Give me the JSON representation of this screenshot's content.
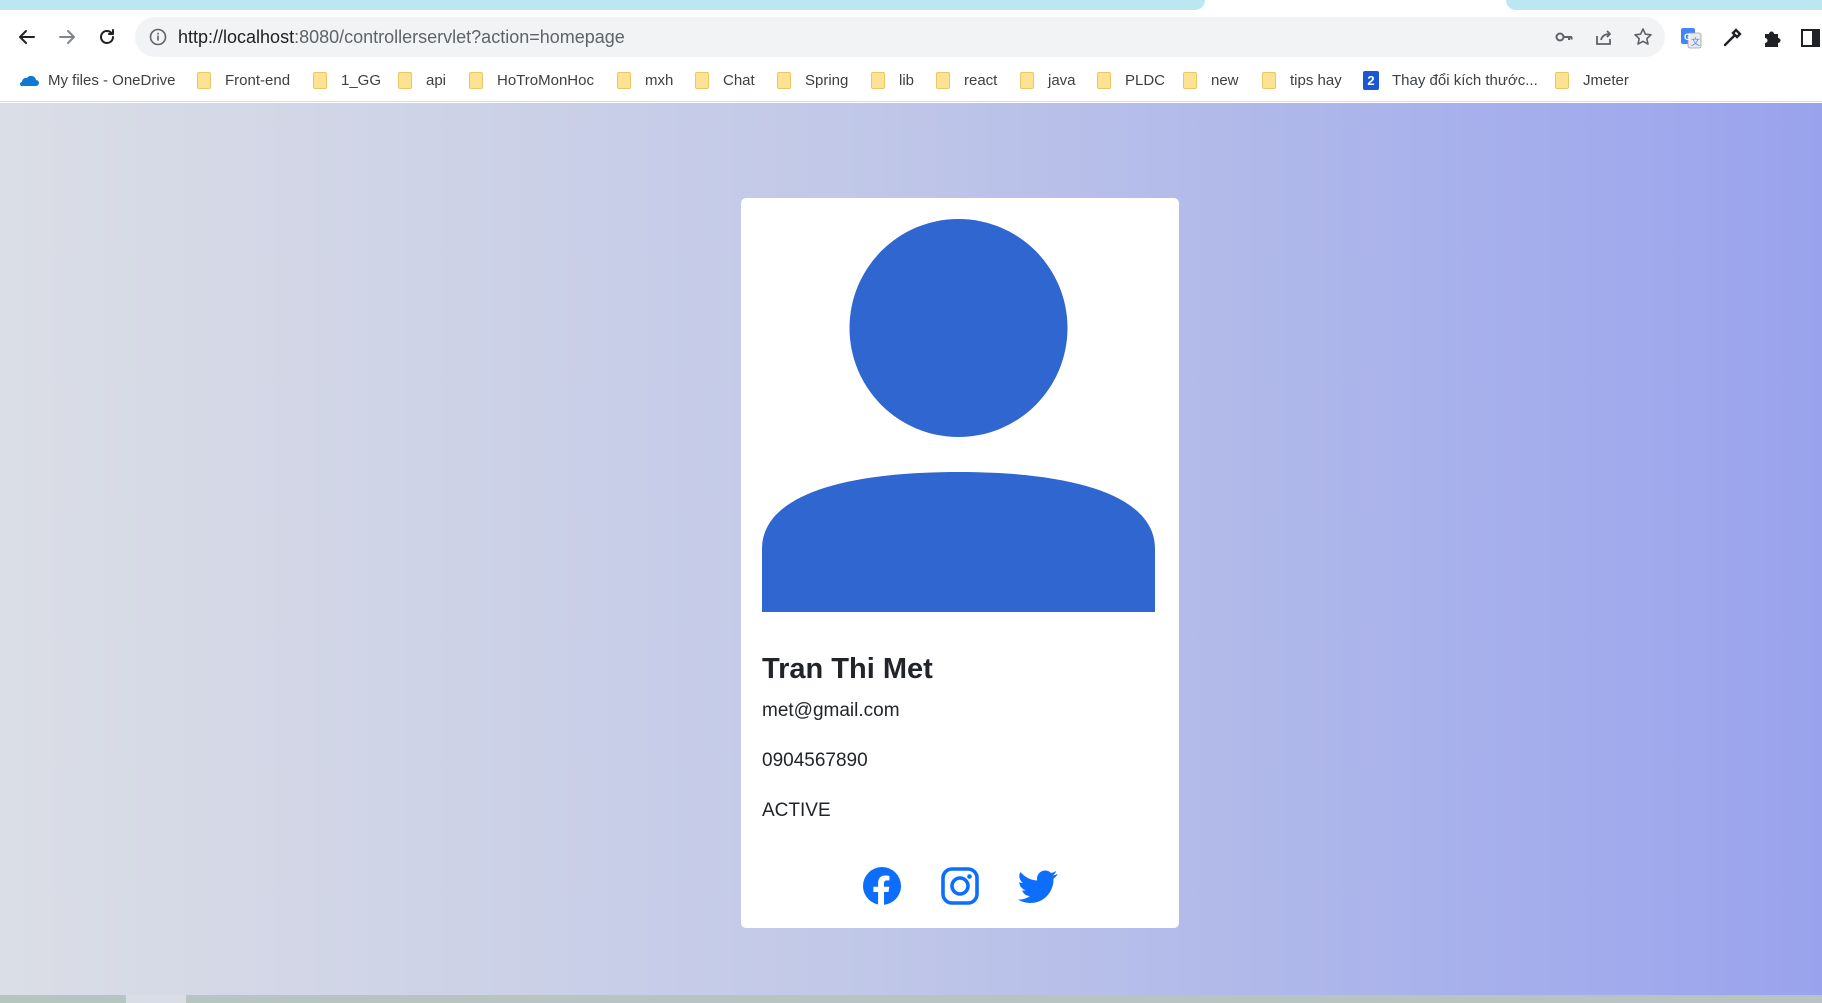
{
  "browser": {
    "url_host": "http://localhost",
    "url_path": ":8080/controllerservlet?action=homepage"
  },
  "bookmarks": [
    {
      "label": "My files - OneDrive",
      "icon": "onedrive-icon"
    },
    {
      "label": "Front-end",
      "icon": "folder-icon"
    },
    {
      "label": "1_GG",
      "icon": "folder-icon"
    },
    {
      "label": "api",
      "icon": "folder-icon"
    },
    {
      "label": "HoTroMonHoc",
      "icon": "folder-icon"
    },
    {
      "label": "mxh",
      "icon": "folder-icon"
    },
    {
      "label": "Chat",
      "icon": "folder-icon"
    },
    {
      "label": "Spring",
      "icon": "folder-icon"
    },
    {
      "label": "lib",
      "icon": "folder-icon"
    },
    {
      "label": "react",
      "icon": "folder-icon"
    },
    {
      "label": "java",
      "icon": "folder-icon"
    },
    {
      "label": "PLDC",
      "icon": "folder-icon"
    },
    {
      "label": "new",
      "icon": "folder-icon"
    },
    {
      "label": "tips hay",
      "icon": "folder-icon"
    },
    {
      "label": "Thay đổi kích thước...",
      "icon": "site-2-icon",
      "badge": "2"
    },
    {
      "label": "Jmeter",
      "icon": "folder-icon"
    }
  ],
  "profile": {
    "name": "Tran Thi Met",
    "email": "met@gmail.com",
    "phone": "0904567890",
    "status": "ACTIVE"
  },
  "colors": {
    "avatar": "#3066cf",
    "social": "#0d6efd",
    "gradient_left": "#dbdee6",
    "gradient_right": "#99a3ed"
  }
}
